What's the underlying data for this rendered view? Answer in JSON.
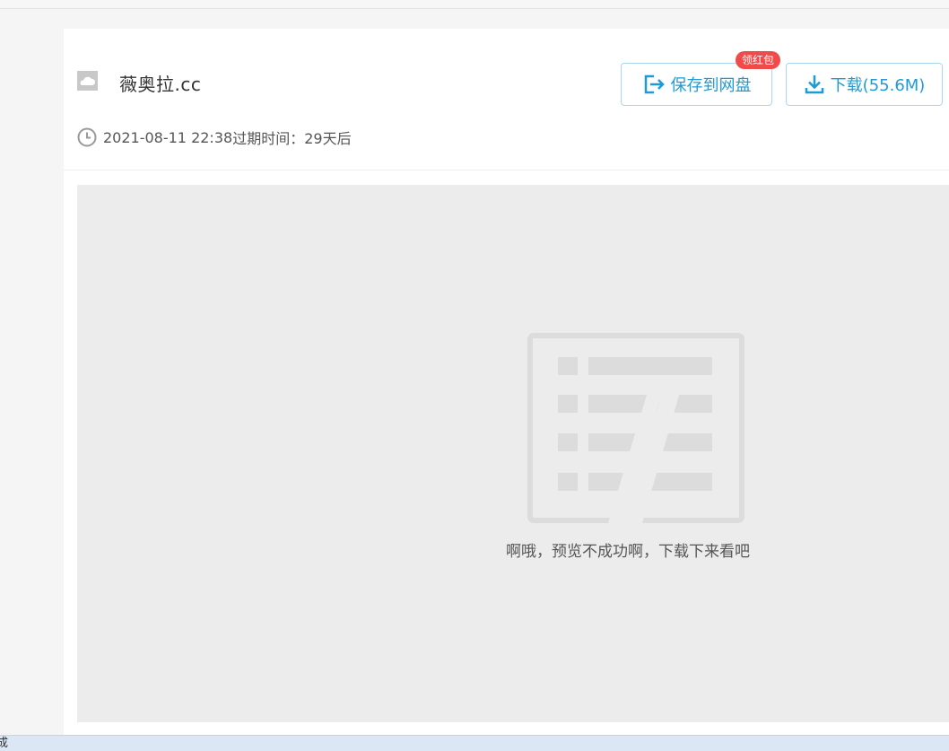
{
  "file": {
    "name": "薇奥拉.cc",
    "date": "2021-08-11 22:38",
    "expire_label": "过期时间：",
    "expire_value": "29天后"
  },
  "buttons": {
    "save_label": "保存到网盘",
    "download_label": "下载(55.6M)",
    "badge": "领红包"
  },
  "preview": {
    "message": "啊哦，预览不成功啊，下载下来看吧"
  },
  "status_bar": {
    "text": "成"
  },
  "colors": {
    "accent": "#1d9bd7",
    "badge": "#f04a4a"
  }
}
